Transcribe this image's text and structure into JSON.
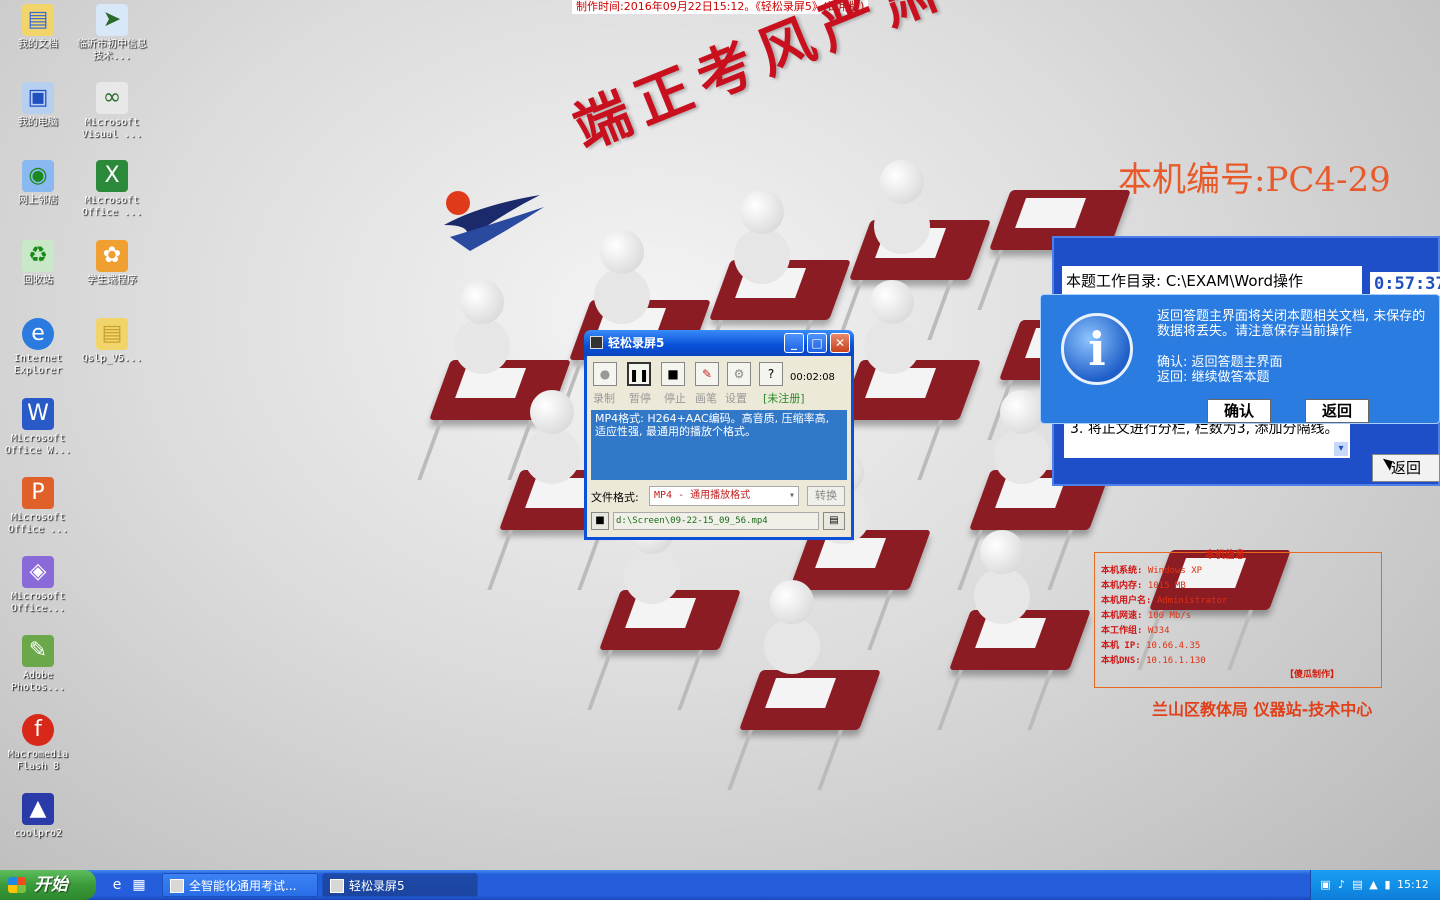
{
  "banner": "制作时间:2016年09月22日15:12。《轻松录屏5》(试用版)",
  "slogan": "端正考风严肃考纪",
  "machine_id": "本机编号:PC4-29",
  "desktop_icons": [
    {
      "label": "我的文档",
      "icon": "my-documents-icon"
    },
    {
      "label": "临沂市初中信息技术...",
      "icon": "shortcut-icon"
    },
    {
      "label": "我的电脑",
      "icon": "my-computer-icon"
    },
    {
      "label": "Microsoft Visual ...",
      "icon": "visual-studio-icon"
    },
    {
      "label": "网上邻居",
      "icon": "network-icon"
    },
    {
      "label": "Microsoft Office ...",
      "icon": "excel-icon"
    },
    {
      "label": "回收站",
      "icon": "recycle-bin-icon"
    },
    {
      "label": "学生端程序",
      "icon": "student-app-icon"
    },
    {
      "label": "Internet Explorer",
      "icon": "ie-icon"
    },
    {
      "label": "Qslp_V5...",
      "icon": "folder-icon"
    },
    {
      "label": "Microsoft Office W...",
      "icon": "word-icon"
    },
    {
      "label": "Microsoft Office ...",
      "icon": "powerpoint-icon"
    },
    {
      "label": "Microsoft Office...",
      "icon": "picture-manager-icon"
    },
    {
      "label": "Adobe Photos...",
      "icon": "photoshop-icon"
    },
    {
      "label": "Macromedia Flash 8",
      "icon": "flash-icon"
    },
    {
      "label": "coolpro2",
      "icon": "coolpro-icon"
    }
  ],
  "recorder": {
    "title": "轻松录屏5",
    "time": "00:02:08",
    "labels": [
      "录制",
      "暂停",
      "停止",
      "画笔",
      "设置"
    ],
    "register": "[未注册]",
    "description": "MP4格式: H264+AAC编码。高音质, 压缩率高, 适应性强, 最通用的播放个格式。",
    "format_label": "文件格式:",
    "format_value": "MP4 - 通用播放格式",
    "convert_label": "转换",
    "path": "d:\\Screen\\09-22-15_09_56.mp4"
  },
  "exam": {
    "dir": "本题工作目录: C:\\EXAM\\Word操作",
    "timer": "0:57:37",
    "question": "3. 将正文进行分栏, 栏数为3, 添加分隔线。",
    "back_label": "返回"
  },
  "confirm": {
    "msg1": "返回答题主界面将关闭本题相关文档, 未保存的数据将丢失。请注意保存当前操作",
    "msg2": "确认: 返回答题主界面",
    "msg3": "返回: 继续做答本题",
    "ok_label": "确认",
    "back_label": "返回"
  },
  "info_box": {
    "legend": "本机信息",
    "rows": [
      {
        "k": "本机系统:",
        "v": "Windows XP"
      },
      {
        "k": "本机内存:",
        "v": "1015 MB"
      },
      {
        "k": "本机用户名:",
        "v": "Administrator"
      },
      {
        "k": "本机网速:",
        "v": "100 Mb/s"
      },
      {
        "k": "本工作组:",
        "v": "WJ34"
      },
      {
        "k": "本机 IP:",
        "v": "10.66.4.35"
      },
      {
        "k": "本机DNS:",
        "v": "10.16.1.130"
      }
    ],
    "made": "【傻瓜制作】"
  },
  "footer_org": "兰山区教体局 仪器站-技术中心",
  "taskbar": {
    "start": "开始",
    "tasks": [
      "全智能化通用考试...",
      "轻松录屏5"
    ],
    "clock": "15:12"
  }
}
